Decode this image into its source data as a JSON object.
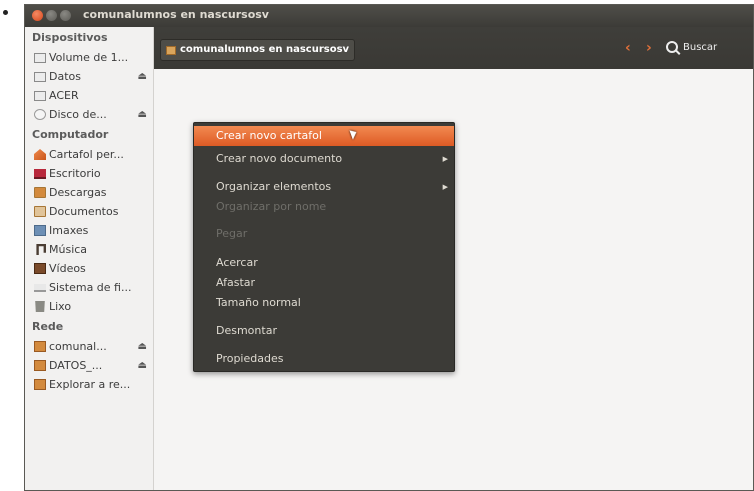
{
  "window": {
    "title": "comunalumnos en nascursosv"
  },
  "sidebar": {
    "sections": [
      {
        "heading": "Dispositivos",
        "items": [
          {
            "label": "Volume de 1...",
            "icon": "drive-icon",
            "eject": false
          },
          {
            "label": "Datos",
            "icon": "drive-icon",
            "eject": true
          },
          {
            "label": "ACER",
            "icon": "drive-icon",
            "eject": false
          },
          {
            "label": "Disco de...",
            "icon": "disc-icon",
            "eject": true
          }
        ]
      },
      {
        "heading": "Computador",
        "items": [
          {
            "label": "Cartafol per...",
            "icon": "home-folder-icon"
          },
          {
            "label": "Escritorio",
            "icon": "desktop-icon"
          },
          {
            "label": "Descargas",
            "icon": "downloads-folder-icon"
          },
          {
            "label": "Documentos",
            "icon": "documents-folder-icon"
          },
          {
            "label": "Imaxes",
            "icon": "pictures-folder-icon"
          },
          {
            "label": "Música",
            "icon": "music-folder-icon"
          },
          {
            "label": "Vídeos",
            "icon": "videos-folder-icon"
          },
          {
            "label": "Sistema de fi...",
            "icon": "filesystem-icon"
          },
          {
            "label": "Lixo",
            "icon": "trash-icon"
          }
        ]
      },
      {
        "heading": "Rede",
        "items": [
          {
            "label": "comunal...",
            "icon": "network-share-icon",
            "eject": true
          },
          {
            "label": "DATOS_...",
            "icon": "network-share-icon",
            "eject": true
          },
          {
            "label": "Explorar a re...",
            "icon": "network-share-icon"
          }
        ]
      }
    ],
    "eject_glyph": "⏏"
  },
  "toolbar": {
    "path_label": "comunalumnos en nascursosv",
    "back_glyph": "‹",
    "forward_glyph": "›",
    "search_label": "Buscar"
  },
  "context_menu": {
    "items": [
      {
        "label": "Crear novo cartafol",
        "state": "active"
      },
      {
        "label": "Crear novo documento",
        "submenu": true
      },
      {
        "label": "Organizar elementos",
        "submenu": true
      },
      {
        "label": "Organizar por nome",
        "state": "disabled"
      },
      {
        "label": "Pegar",
        "state": "disabled"
      },
      {
        "label": "Acercar"
      },
      {
        "label": "Afastar"
      },
      {
        "label": "Tamaño normal"
      },
      {
        "label": "Desmontar"
      },
      {
        "label": "Propiedades"
      }
    ],
    "submenu_glyph": "▶"
  },
  "colors": {
    "accent": "#e0703a",
    "titlebar": "#3c3b37",
    "menu_bg": "#3c3b37",
    "sidebar_bg": "#f2f1f0"
  }
}
